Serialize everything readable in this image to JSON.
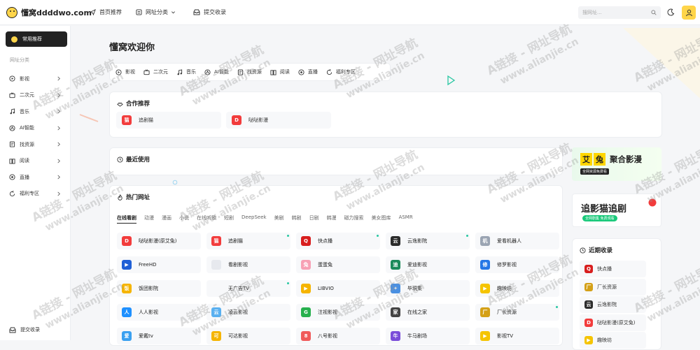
{
  "header": {
    "logo_text": "懂窝ddddwo.com",
    "nav": [
      {
        "label": "首页推荐",
        "icon": "send-icon"
      },
      {
        "label": "网址分类",
        "icon": "category-icon"
      },
      {
        "label": "提交收录",
        "icon": "inbox-icon"
      }
    ],
    "search_placeholder": "搜网址..."
  },
  "sidebar": {
    "active_label": "常用推荐",
    "section_label": "网址分类",
    "items": [
      {
        "label": "影视",
        "icon": "play-icon"
      },
      {
        "label": "二次元",
        "icon": "tv-icon"
      },
      {
        "label": "音乐",
        "icon": "music-icon"
      },
      {
        "label": "AI智能",
        "icon": "ai-icon"
      },
      {
        "label": "找资源",
        "icon": "resource-icon"
      },
      {
        "label": "阅读",
        "icon": "book-icon"
      },
      {
        "label": "直播",
        "icon": "live-icon"
      },
      {
        "label": "福利专区",
        "icon": "gift-icon"
      }
    ],
    "bottom_label": "提交收录"
  },
  "main": {
    "welcome": "懂窝欢迎你",
    "quick_links": [
      {
        "label": "影视",
        "icon": "play-icon"
      },
      {
        "label": "二次元",
        "icon": "tv-icon"
      },
      {
        "label": "音乐",
        "icon": "music-icon"
      },
      {
        "label": "AI智能",
        "icon": "ai-icon"
      },
      {
        "label": "找资源",
        "icon": "resource-icon"
      },
      {
        "label": "阅读",
        "icon": "book-icon"
      },
      {
        "label": "直播",
        "icon": "live-icon"
      },
      {
        "label": "福利专区",
        "icon": "gift-icon"
      }
    ],
    "cooperation": {
      "title": "合作推荐",
      "items": [
        {
          "name": "追剧猫",
          "color": "#f23c3c",
          "glyph": "猫"
        },
        {
          "name": "哒哒影漫",
          "color": "#f23c3c",
          "glyph": "D"
        }
      ]
    },
    "recent_use": {
      "title": "最近使用"
    },
    "hot": {
      "title": "热门网址",
      "tabs": [
        "在线看剧",
        "动漫",
        "漫画",
        "小说",
        "在线听歌",
        "短剧",
        "DeepSeek",
        "美剧",
        "韩剧",
        "日剧",
        "韩漫",
        "磁力搜索",
        "美女图库",
        "ASMR"
      ],
      "sites": [
        {
          "name": "哒哒影漫(原艾兔)",
          "color": "#f23c3c",
          "glyph": "D",
          "dot": false
        },
        {
          "name": "追剧猫",
          "color": "#f23c3c",
          "glyph": "猫",
          "dot": true
        },
        {
          "name": "快点播",
          "color": "#d81e1e",
          "glyph": "Q",
          "dot": true
        },
        {
          "name": "云逸影院",
          "color": "#2b2b2b",
          "glyph": "云",
          "dot": true
        },
        {
          "name": "爱看机器人",
          "color": "#9aa4b2",
          "glyph": "机",
          "dot": false
        },
        {
          "name": "FreeHD",
          "color": "#1f5fd6",
          "glyph": "▶",
          "dot": false
        },
        {
          "name": "看剧影视",
          "color": "#e7e9ee",
          "glyph": "",
          "dot": false
        },
        {
          "name": "蛋蛋兔",
          "color": "#f7a1b5",
          "glyph": "兔",
          "dot": false
        },
        {
          "name": "爱迪影视",
          "color": "#1c8a5a",
          "glyph": "迪",
          "dot": false
        },
        {
          "name": "修罗影视",
          "color": "#2677e6",
          "glyph": "修",
          "dot": false
        },
        {
          "name": "饭团影院",
          "color": "#f5b400",
          "glyph": "饭",
          "dot": false
        },
        {
          "name": "无广告TV",
          "color": "#f7f8fa",
          "glyph": "",
          "dot": true
        },
        {
          "name": "LIBVIO",
          "color": "#f5b400",
          "glyph": "▶",
          "dot": false
        },
        {
          "name": "毕現集",
          "color": "#4a90e2",
          "glyph": "✦",
          "dot": false
        },
        {
          "name": "趣映坊",
          "color": "#f5c400",
          "glyph": "▶",
          "dot": false
        },
        {
          "name": "人人影视",
          "color": "#1e90ff",
          "glyph": "人",
          "dot": false
        },
        {
          "name": "凌云影视",
          "color": "#5ab0f0",
          "glyph": "云",
          "dot": false
        },
        {
          "name": "注视影视",
          "color": "#27b04e",
          "glyph": "G",
          "dot": false
        },
        {
          "name": "在线之家",
          "color": "#444444",
          "glyph": "家",
          "dot": false
        },
        {
          "name": "厂长资源",
          "color": "#d4a017",
          "glyph": "厂",
          "dot": true
        },
        {
          "name": "爱戴tv",
          "color": "#3aa0f0",
          "glyph": "爱",
          "dot": false
        },
        {
          "name": "可达影视",
          "color": "#f5b400",
          "glyph": "可",
          "dot": false
        },
        {
          "name": "八号影视",
          "color": "#f05a5a",
          "glyph": "8",
          "dot": false
        },
        {
          "name": "牛马剧场",
          "color": "#7a4cd9",
          "glyph": "牛",
          "dot": false
        },
        {
          "name": "影视TV",
          "color": "#f5c400",
          "glyph": "▶",
          "dot": false
        }
      ]
    }
  },
  "right": {
    "banner1": {
      "badge": [
        "艾",
        "兔"
      ],
      "title": "聚合影漫",
      "sub": "全网资源免费看"
    },
    "banner2": {
      "title": "追影猫追剧",
      "sub": "全网剧集 免费观看"
    },
    "recent": {
      "title": "近期收录",
      "items": [
        {
          "name": "快点播",
          "color": "#d81e1e",
          "glyph": "Q"
        },
        {
          "name": "厂长资源",
          "color": "#d4a017",
          "glyph": "厂"
        },
        {
          "name": "云逸影院",
          "color": "#2b2b2b",
          "glyph": "云"
        },
        {
          "name": "哒哒影漫(原艾兔)",
          "color": "#f23c3c",
          "glyph": "D"
        },
        {
          "name": "趣映坊",
          "color": "#f5c400",
          "glyph": "▶"
        }
      ]
    }
  },
  "watermark": {
    "line1": "A链接 - 网址导航",
    "line2": "www.alianjie.cn"
  }
}
